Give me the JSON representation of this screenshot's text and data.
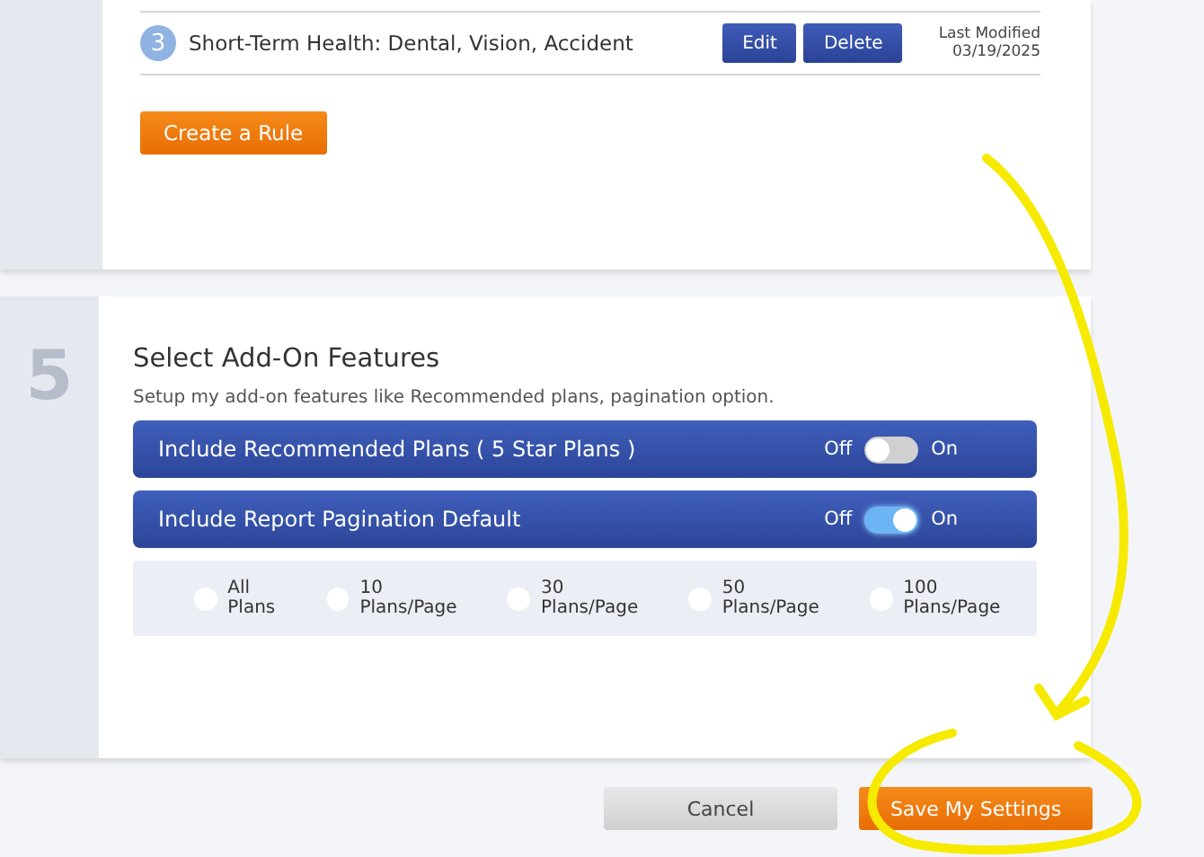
{
  "rules": [
    {
      "number": "3",
      "name": "Short-Term Health: Dental, Vision, Accident",
      "actions": [
        "Edit",
        "Delete"
      ],
      "modified_label": "Last Modified",
      "modified_date": "03/19/2025"
    }
  ],
  "create_button": "Create a Rule",
  "section": {
    "number": "5",
    "title": "Select Add-On Features",
    "description": "Setup my add-on features like Recommended plans, pagination option.",
    "toggles": [
      {
        "label": "Include Recommended Plans ( 5 Star Plans )",
        "off_label": "Off",
        "on_label": "On",
        "on": false
      },
      {
        "label": "Include Report Pagination Default",
        "off_label": "Off",
        "on_label": "On",
        "on": true
      }
    ],
    "pagination_options": [
      {
        "label": "All Plans",
        "selected": false
      },
      {
        "label": "10 Plans/Page",
        "selected": false
      },
      {
        "label": "30 Plans/Page",
        "selected": false
      },
      {
        "label": "50 Plans/Page",
        "selected": false
      },
      {
        "label": "100 Plans/Page",
        "selected": false
      }
    ]
  },
  "buttons": [
    {
      "label": "Cancel",
      "kind": "secondary"
    },
    {
      "label": "Save My Settings",
      "kind": "primary"
    }
  ]
}
